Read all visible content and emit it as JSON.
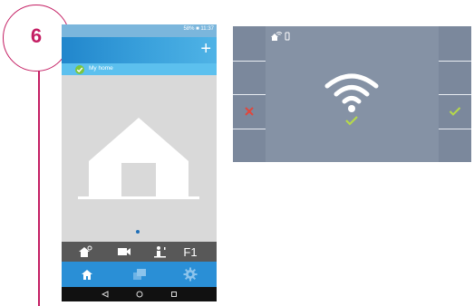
{
  "step": {
    "number": "6"
  },
  "app": {
    "status_bar": {
      "text": "58% ■ 11:37"
    },
    "header": {
      "add_label": "+"
    },
    "home_list": [
      {
        "label": "My home",
        "selected": true
      }
    ],
    "page_indicator": {
      "pages": 1,
      "current": 1
    },
    "action_bar": {
      "items": [
        {
          "icon": "house-key-icon"
        },
        {
          "icon": "camera-icon"
        },
        {
          "icon": "door-person-icon"
        },
        {
          "label": "F1"
        }
      ]
    },
    "bottom_nav": {
      "items": [
        {
          "icon": "home-icon",
          "active": true
        },
        {
          "icon": "messages-icon",
          "active": false
        },
        {
          "icon": "settings-gear-icon",
          "active": false
        }
      ]
    },
    "system_nav": {
      "items": [
        "back-icon",
        "home-circle-icon",
        "recents-icon"
      ]
    },
    "colors": {
      "accent": "#2a8fd6",
      "selected_row": "#5cc0ee",
      "check": "#7cc63f"
    }
  },
  "monitor": {
    "status_icons": [
      "house-wifi-icon",
      "phone-icon"
    ],
    "center_icon": "wifi-icon",
    "center_status": "check-icon",
    "left_buttons": [
      "",
      "",
      "reject-x-icon",
      ""
    ],
    "right_buttons": [
      "",
      "",
      "accept-check-icon",
      ""
    ],
    "colors": {
      "screen": "#8592a5",
      "reject": "#e0473c",
      "accept": "#b6d94a"
    }
  }
}
